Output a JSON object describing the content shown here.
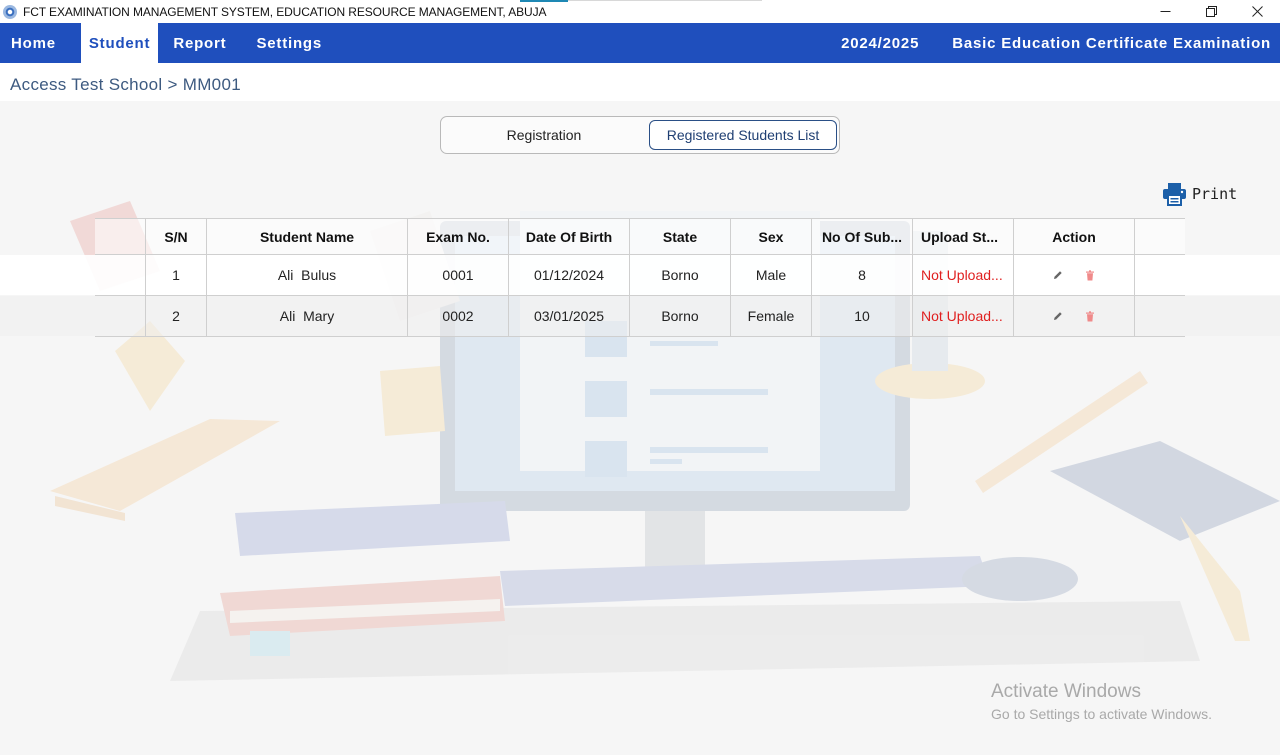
{
  "window": {
    "title": "FCT EXAMINATION MANAGEMENT SYSTEM, EDUCATION RESOURCE MANAGEMENT, ABUJA",
    "minimize": "─",
    "restore": "❐",
    "close": "✕"
  },
  "nav": {
    "items": [
      {
        "label": "Home"
      },
      {
        "label": "Student"
      },
      {
        "label": "Report"
      },
      {
        "label": "Settings"
      }
    ],
    "active": "Student",
    "session": "2024/2025",
    "exam": "Basic Education Certificate Examination",
    "bar_color": "#1f4fbd"
  },
  "breadcrumb": "Access Test School > MM001",
  "tabs": {
    "registration": "Registration",
    "registered_list": "Registered Students List",
    "selected": "Registered Students List"
  },
  "print": {
    "label": "Print",
    "icon": "printer-icon"
  },
  "table": {
    "headers": {
      "sn": "S/N",
      "name": "Student Name",
      "exam_no": "Exam No.",
      "dob": "Date Of Birth",
      "state": "State",
      "sex": "Sex",
      "subjects": "No Of Sub...",
      "upload": "Upload St...",
      "action": "Action"
    },
    "rows": [
      {
        "sn": "1",
        "name": "Ali  Bulus",
        "exam_no": "0001",
        "dob": "01/12/2024",
        "state": "Borno",
        "sex": "Male",
        "subjects": "8",
        "upload": "Not Upload..."
      },
      {
        "sn": "2",
        "name": "Ali  Mary",
        "exam_no": "0002",
        "dob": "03/01/2025",
        "state": "Borno",
        "sex": "Female",
        "subjects": "10",
        "upload": "Not Upload..."
      }
    ],
    "status_color": "#e01f1f"
  },
  "watermark": {
    "line1": "Activate Windows",
    "line2": "Go to Settings to activate Windows."
  }
}
